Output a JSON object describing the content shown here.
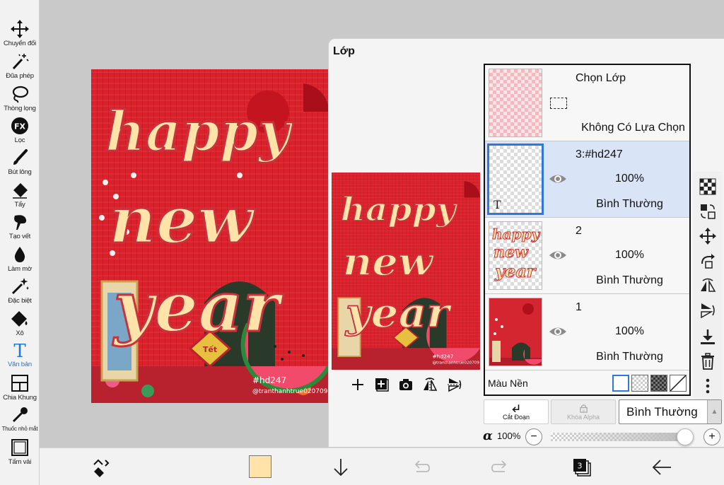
{
  "tools": [
    {
      "id": "transform",
      "label": "Chuyển đổi",
      "icon": "move-arrows-icon"
    },
    {
      "id": "magic-wand",
      "label": "Đũa phép",
      "icon": "magic-wand-icon"
    },
    {
      "id": "lasso",
      "label": "Thòng lọng",
      "icon": "lasso-icon"
    },
    {
      "id": "filter",
      "label": "Lọc",
      "icon": "fx-icon"
    },
    {
      "id": "brush",
      "label": "Bút lông",
      "icon": "brush-icon"
    },
    {
      "id": "eraser",
      "label": "Tẩy",
      "icon": "eraser-icon"
    },
    {
      "id": "smudge",
      "label": "Tạo vết",
      "icon": "smudge-icon"
    },
    {
      "id": "blur",
      "label": "Làm mờ",
      "icon": "drop-icon"
    },
    {
      "id": "special",
      "label": "Đặc biệt",
      "icon": "sparkle-icon"
    },
    {
      "id": "bucket",
      "label": "Xô",
      "icon": "bucket-icon"
    },
    {
      "id": "text",
      "label": "Văn bản",
      "icon": "text-T-icon",
      "active": true
    },
    {
      "id": "frame-divider",
      "label": "Chia Khung",
      "icon": "frame-divider-icon"
    },
    {
      "id": "eyedropper",
      "label": "Thuốc nhỏ mắt",
      "icon": "eyedropper-icon"
    },
    {
      "id": "canvas",
      "label": "Tấm vải",
      "icon": "canvas-icon"
    }
  ],
  "artwork": {
    "line1": "happy",
    "line2": "new",
    "line3": "year",
    "badge": "Tết",
    "hashtag": "#hd247",
    "credit": "@tranthanhtrue020709"
  },
  "layer_panel": {
    "title": "Lớp",
    "selection_layer": {
      "title": "Chọn Lớp",
      "status": "Không Có Lựa Chọn"
    },
    "layers": [
      {
        "name": "3:#hd247",
        "opacity": "100%",
        "blend": "Bình Thường",
        "selected": true
      },
      {
        "name": "2",
        "opacity": "100%",
        "blend": "Bình Thường",
        "selected": false
      },
      {
        "name": "1",
        "opacity": "100%",
        "blend": "Bình Thường",
        "selected": false
      }
    ],
    "background_label": "Màu Nền",
    "clip_label": "Cắt Đoạn",
    "alpha_lock_label": "Khóa Alpha",
    "blend_mode": "Bình Thường",
    "alpha_symbol": "α",
    "alpha_value": "100%",
    "alpha_fraction": 1.0
  },
  "bottom_bar": {
    "layer_count": "3",
    "primary_color": "#ffe3a8"
  },
  "colors": {
    "accent": "#1e78d8",
    "selected_row": "#d9e5f6",
    "art_red": "#d9222c"
  }
}
